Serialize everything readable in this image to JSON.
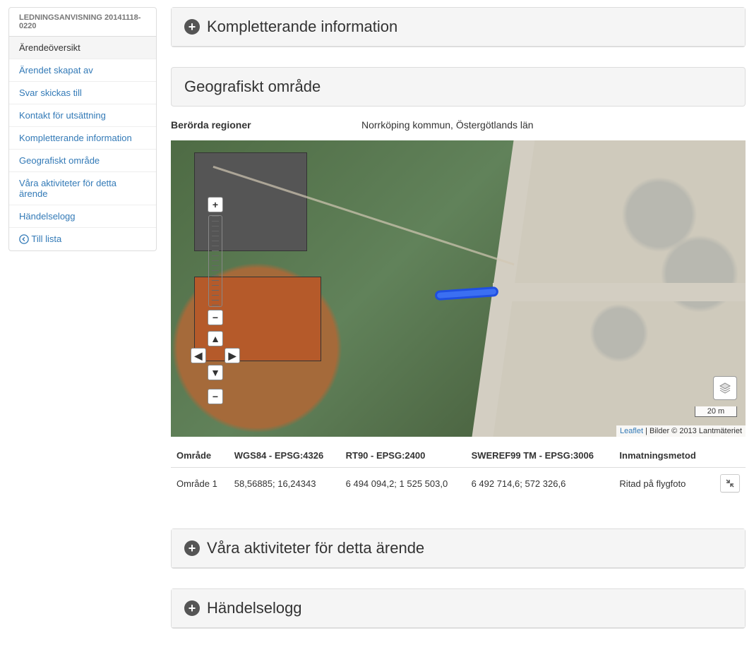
{
  "sidebar": {
    "header": "LEDNINGSANVISNING 20141118-0220",
    "items": [
      {
        "label": "Ärendeöversikt",
        "active": true
      },
      {
        "label": "Ärendet skapat av",
        "active": false
      },
      {
        "label": "Svar skickas till",
        "active": false
      },
      {
        "label": "Kontakt för utsättning",
        "active": false
      },
      {
        "label": "Kompletterande information",
        "active": false
      },
      {
        "label": "Geografiskt område",
        "active": false
      },
      {
        "label": "Våra aktiviteter för detta ärende",
        "active": false
      },
      {
        "label": "Händelselogg",
        "active": false
      }
    ],
    "back_label": "Till lista"
  },
  "panels": {
    "supplementary_title": "Kompletterande information",
    "geo_title": "Geografiskt område",
    "activities_title": "Våra aktiviteter för detta ärende",
    "eventlog_title": "Händelselogg"
  },
  "geo": {
    "regions_label": "Berörda regioner",
    "regions_value": "Norrköping kommun, Östergötlands län",
    "scale_label": "20 m",
    "attribution_link": "Leaflet",
    "attribution_text": " | Bilder © 2013 Lantmäteriet",
    "table": {
      "headers": {
        "area": "Område",
        "wgs84": "WGS84 - EPSG:4326",
        "rt90": "RT90 - EPSG:2400",
        "sweref99": "SWEREF99 TM - EPSG:3006",
        "method": "Inmatningsmetod"
      },
      "rows": [
        {
          "area": "Område 1",
          "wgs84": "58,56885; 16,24343",
          "rt90": "6 494 094,2; 1 525 503,0",
          "sweref99": "6 492 714,6; 572 326,6",
          "method": "Ritad på flygfoto"
        }
      ]
    }
  },
  "map_controls": {
    "zoom_in": "+",
    "zoom_out": "−",
    "pan_up": "▲",
    "pan_down": "▼",
    "pan_left": "◀",
    "pan_right": "▶"
  }
}
